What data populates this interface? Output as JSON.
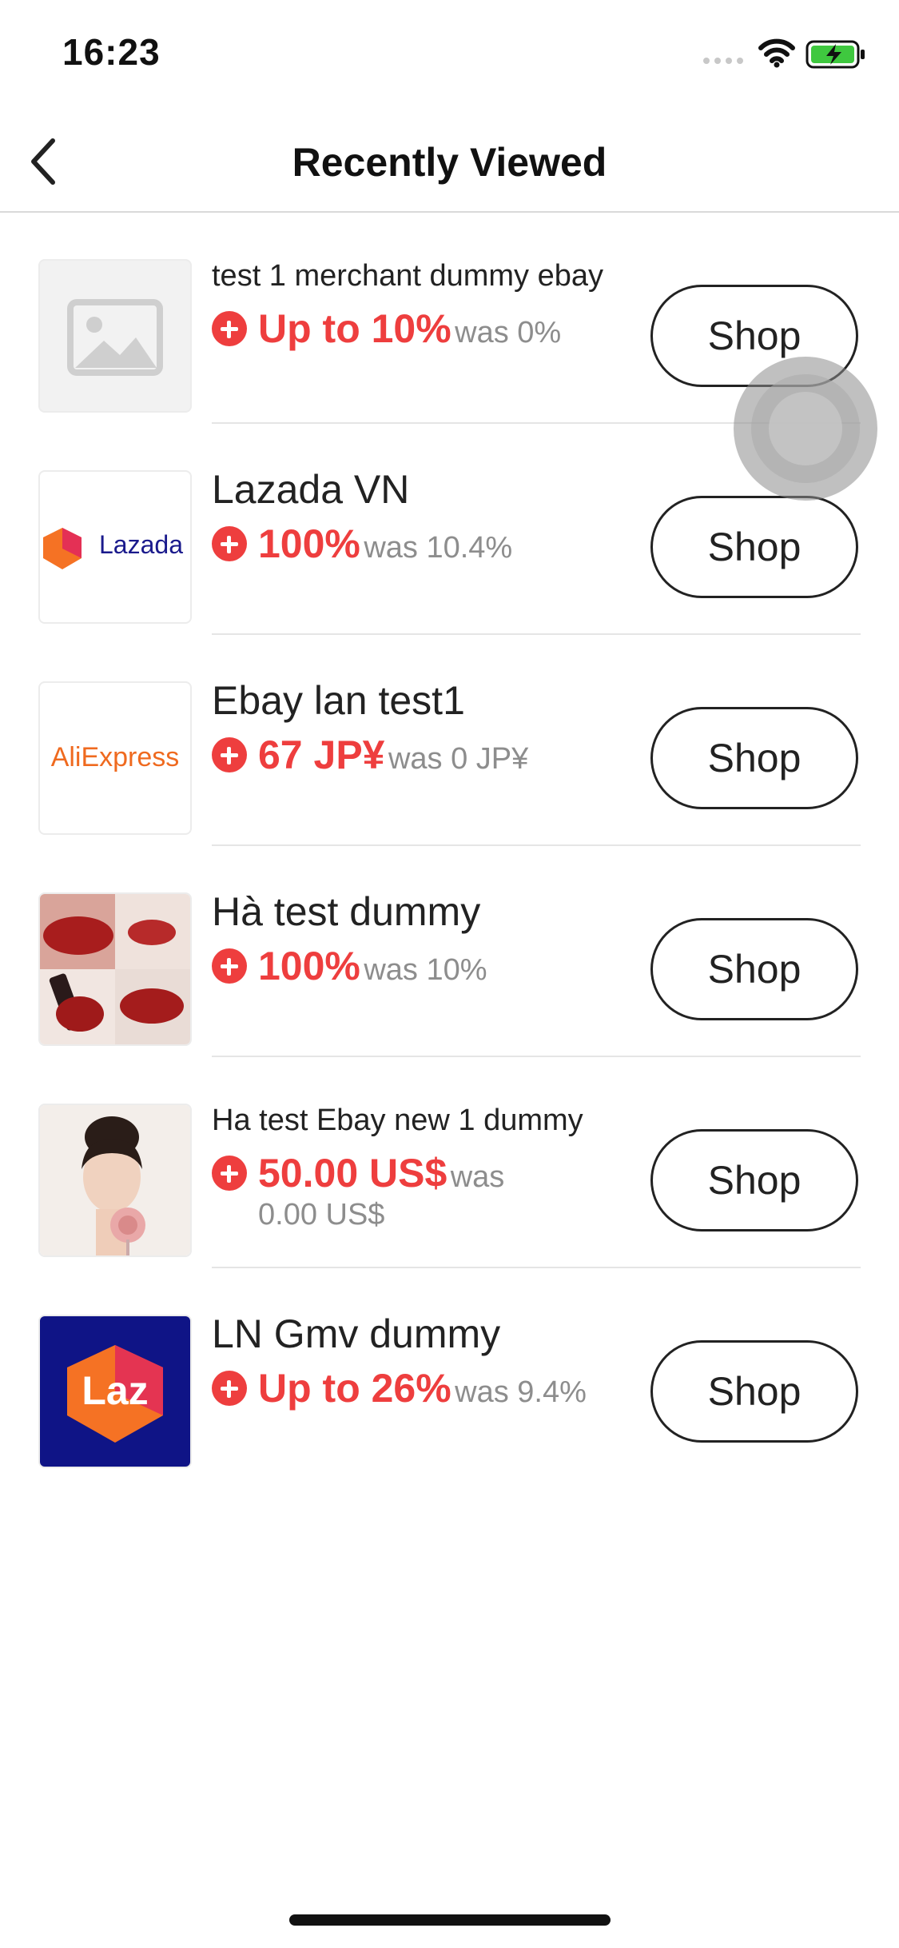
{
  "status_bar": {
    "time": "16:23",
    "icons": [
      "signal-icon",
      "wifi-icon",
      "battery-charging-icon"
    ],
    "battery_color": "#3fc83f"
  },
  "header": {
    "title": "Recently Viewed",
    "back_icon": "chevron-left-icon"
  },
  "colors": {
    "accent_red": "#ee3e3e",
    "muted_text": "#8d8d8d"
  },
  "items": [
    {
      "name": "test 1 merchant dummy ebay",
      "rate": "Up to 10%",
      "was": "was 0%",
      "shop_label": "Shop",
      "thumbnail": "image-placeholder-icon"
    },
    {
      "name": "Lazada VN",
      "rate": "100%",
      "was": "was 10.4%",
      "shop_label": "Shop",
      "thumbnail": "lazada-logo",
      "logo_text": "Lazada"
    },
    {
      "name": "Ebay lan test1",
      "rate": "67 JP¥",
      "was": "was 0 JP¥",
      "shop_label": "Shop",
      "thumbnail": "aliexpress-logo",
      "logo_text": "AliExpress"
    },
    {
      "name": "Hà test dummy",
      "rate": "100%",
      "was": "was 10%",
      "shop_label": "Shop",
      "thumbnail": "lipstick-photo"
    },
    {
      "name": "Ha test Ebay new 1 dummy",
      "rate": "50.00 US$",
      "was": "was 0.00 US$",
      "shop_label": "Shop",
      "thumbnail": "portrait-photo"
    },
    {
      "name": "LN Gmv dummy",
      "rate": "Up to 26%",
      "was": "was 9.4%",
      "shop_label": "Shop",
      "thumbnail": "laz-logo",
      "logo_text": "Laz"
    }
  ]
}
